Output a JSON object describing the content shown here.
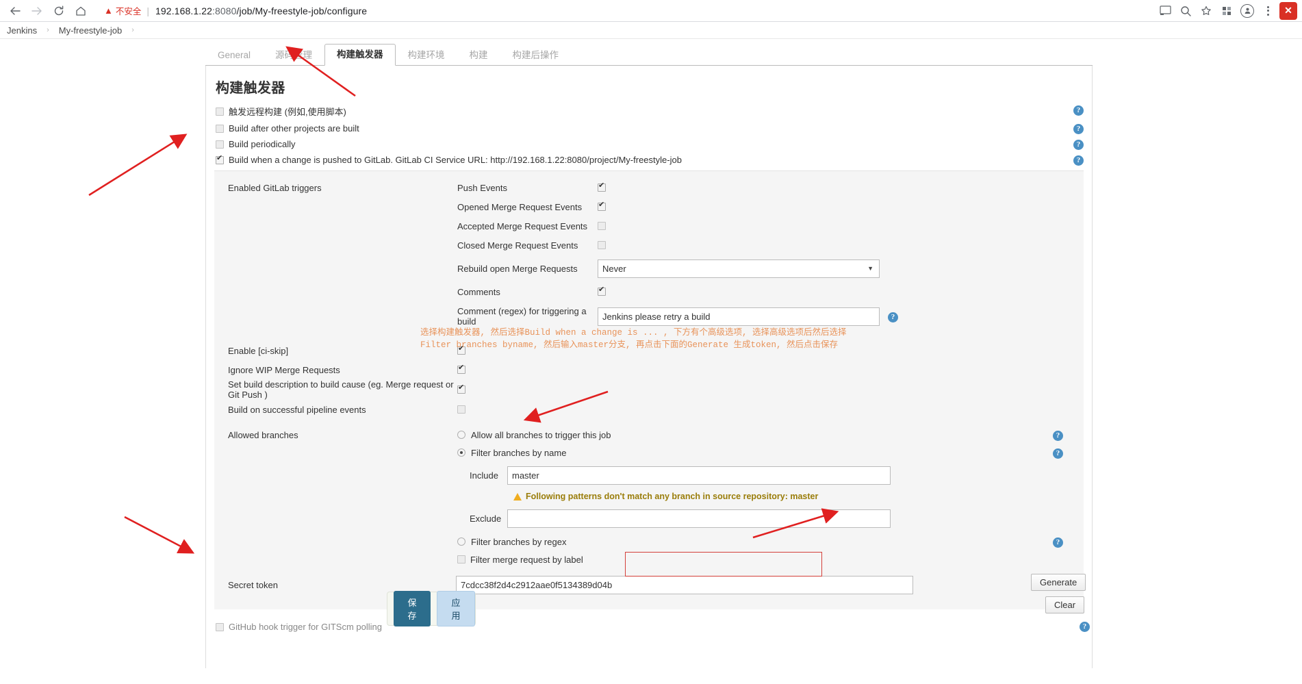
{
  "browser": {
    "back_icon": "back-arrow-icon",
    "forward_icon": "forward-arrow-icon",
    "reload_icon": "reload-icon",
    "home_icon": "home-icon",
    "security_warning": "不安全",
    "url_host": "192.168.1.22",
    "url_port": ":8080",
    "url_path": "/job/My-freestyle-job/configure",
    "cast_icon": "cast-icon",
    "search_icon": "search-icon",
    "bookmark_icon": "star-icon",
    "extension_icon": "extension-icon",
    "profile_icon": "profile-icon",
    "menu_icon": "three-dot-menu-icon",
    "close_icon": "close-icon"
  },
  "breadcrumb": {
    "root": "Jenkins",
    "job": "My-freestyle-job",
    "separator": "›"
  },
  "tabs": [
    {
      "label": "General",
      "active": false
    },
    {
      "label": "源码管理",
      "active": false
    },
    {
      "label": "构建触发器",
      "active": true
    },
    {
      "label": "构建环境",
      "active": false
    },
    {
      "label": "构建",
      "active": false
    },
    {
      "label": "构建后操作",
      "active": false
    }
  ],
  "page_title": "构建触发器",
  "triggers": [
    {
      "label": "触发远程构建 (例如,使用脚本)",
      "checked": false
    },
    {
      "label": "Build after other projects are built",
      "checked": false
    },
    {
      "label": "Build periodically",
      "checked": false
    },
    {
      "label": "Build when a change is pushed to GitLab. GitLab CI Service URL: http://192.168.1.22:8080/project/My-freestyle-job",
      "checked": true
    }
  ],
  "gitlab": {
    "enabled_triggers_label": "Enabled GitLab triggers",
    "events": [
      {
        "label": "Push Events",
        "checked": true
      },
      {
        "label": "Opened Merge Request Events",
        "checked": true
      },
      {
        "label": "Accepted Merge Request Events",
        "checked": false
      },
      {
        "label": "Closed Merge Request Events",
        "checked": false
      }
    ],
    "rebuild_label": "Rebuild open Merge Requests",
    "rebuild_value": "Never",
    "comments_label": "Comments",
    "comments_checked": true,
    "comment_regex_label": "Comment (regex) for triggering a build",
    "comment_regex_value": "Jenkins please retry a build",
    "options": [
      {
        "label": "Enable [ci-skip]",
        "checked": true
      },
      {
        "label": "Ignore WIP Merge Requests",
        "checked": true
      },
      {
        "label": "Set build description to build cause (eg. Merge request or Git Push )",
        "checked": true
      },
      {
        "label": "Build on successful pipeline events",
        "checked": false
      }
    ],
    "allowed_branches_label": "Allowed branches",
    "branch_radios": [
      {
        "label": "Allow all branches to trigger this job",
        "selected": false
      },
      {
        "label": "Filter branches by name",
        "selected": true
      }
    ],
    "include_label": "Include",
    "include_value": "master",
    "warning_text": "Following patterns don't match any branch in source repository: master",
    "exclude_label": "Exclude",
    "exclude_value": "",
    "filter_regex_label": "Filter branches by regex",
    "filter_regex_selected": false,
    "filter_label_label": "Filter merge request by label",
    "filter_label_checked": false,
    "secret_token_label": "Secret token",
    "secret_token_value": "7cdcc38f2d4c2912aae0f5134389d04b",
    "generate_label": "Generate",
    "clear_label": "Clear"
  },
  "footer": {
    "save_label": "保存",
    "apply_label": "应用",
    "gitscm_label": "GitHub hook trigger for GITScm polling",
    "gitscm_checked": false
  },
  "annotation": {
    "line1": "选择构建触发器, 然后选择Build when a change is ... , 下方有个高级选项, 选择高级选项后然后选择",
    "line2": "Filter branches byname, 然后输入master分支, 再点击下面的Generate 生成token, 然后点击保存",
    "color": "#e8935a"
  },
  "colors": {
    "accent": "#2c6d8c",
    "help_blue": "#4a90c4",
    "warn_red": "#d93025",
    "token_outline": "#d43f3a",
    "arrow_red": "#e02020",
    "warn_yellow": "#9a7d0a"
  },
  "help_icon_char": "?"
}
